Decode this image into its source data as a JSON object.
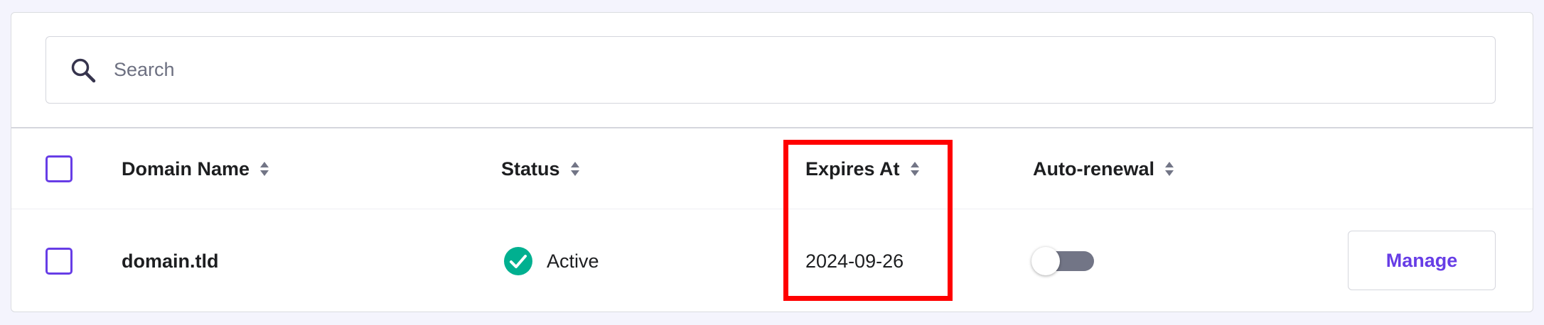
{
  "search": {
    "placeholder": "Search",
    "icon": "search-icon"
  },
  "table": {
    "columns": [
      {
        "label": "Domain Name",
        "sortable": true
      },
      {
        "label": "Status",
        "sortable": true
      },
      {
        "label": "Expires At",
        "sortable": true
      },
      {
        "label": "Auto-renewal",
        "sortable": true
      }
    ],
    "rows": [
      {
        "domain": "domain.tld",
        "status": "Active",
        "status_icon": "check-circle-icon",
        "expires_at": "2024-09-26",
        "auto_renewal": false,
        "action_label": "Manage"
      }
    ]
  },
  "colors": {
    "accent": "#673de6",
    "success": "#00b090",
    "toggle_off": "#727586",
    "highlight": "#ff0000"
  }
}
